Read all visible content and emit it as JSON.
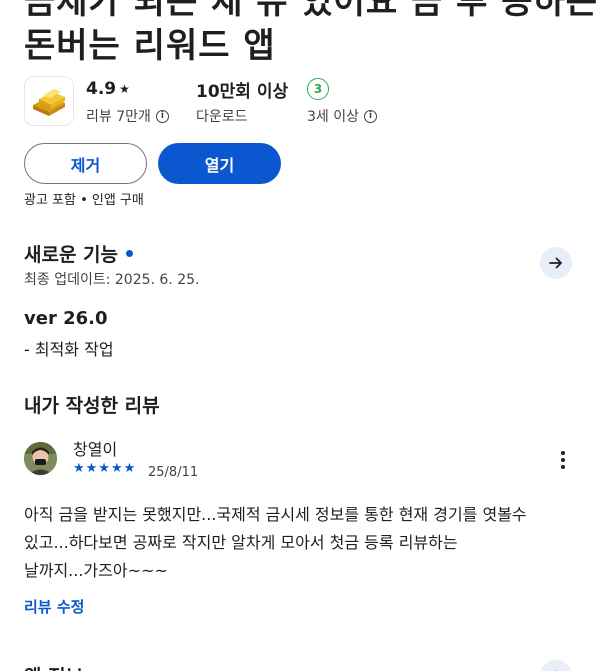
{
  "app": {
    "title_line1": "금제가 되는 재 뉴 있어요 금 투 공하는",
    "title_line2": "돈버는 리워드 앱"
  },
  "stats": {
    "rating_value": "4.9",
    "rating_star": "★",
    "reviews_label": "리뷰 7만개",
    "downloads_value": "10만회 이상",
    "downloads_label": "다운로드",
    "age_badge": "3",
    "age_label": "3세 이상"
  },
  "buttons": {
    "remove_label": "제거",
    "open_label": "열기"
  },
  "ads_line": "광고 포함 • 인앱 구매",
  "whats_new": {
    "title": "새로운 기능",
    "updated": "최종 업데이트: 2025. 6. 25.",
    "version": "ver 26.0",
    "note": "- 최적화 작업"
  },
  "my_review": {
    "section_title": "내가 작성한 리뷰",
    "reviewer": "창열이",
    "stars": "★★★★★",
    "rating": 5,
    "date": "25/8/11",
    "text_line1": "아직 금을 받지는 못했지만...국제적 금시세 정보를 통한 현재 경기를 엿볼수",
    "text_line2": "있고...하다보면 공짜로 작지만 알차게 모아서 첫금 등록 리뷰하는",
    "text_line3": "날까지...가즈아~~~",
    "edit_label": "리뷰 수정"
  },
  "next_section": {
    "title": "앱 정보"
  },
  "colors": {
    "accent": "#0b57d0",
    "age_green": "#34a853",
    "text": "#1f1f1f"
  },
  "icons": {
    "app_icon": "gold-bars-icon",
    "info": "info-icon",
    "arrow": "arrow-right-icon",
    "more": "more-vert-icon"
  }
}
